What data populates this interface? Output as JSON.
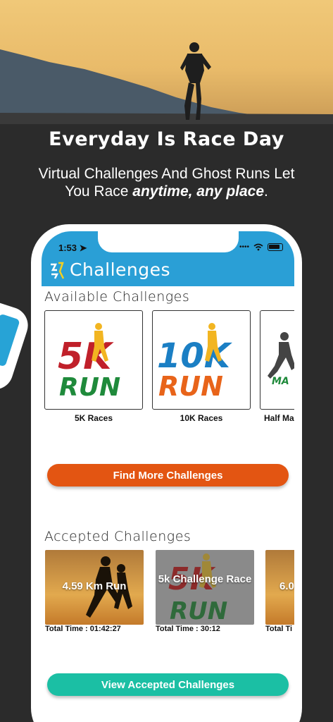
{
  "hero": {
    "headline": "Everyday Is Race Day",
    "subtitle_line1": "Virtual Challenges And Ghost Runs Let",
    "subtitle_line2_pre": "You Race ",
    "subtitle_line2_em": "anytime, any place",
    "subtitle_line2_post": "."
  },
  "status_bar": {
    "time": "1:53"
  },
  "app": {
    "title": "Challenges"
  },
  "available": {
    "title": "Available Challenges",
    "cards": [
      {
        "label": "5K Races",
        "logo_big": "5K",
        "logo_small": "RUN"
      },
      {
        "label": "10K Races",
        "logo_big": "10K",
        "logo_small": "RUN"
      },
      {
        "label": "Half Ma",
        "logo_small": "MA"
      }
    ],
    "button": "Find More Challenges"
  },
  "accepted": {
    "title": "Accepted Challenges",
    "cards": [
      {
        "title": "4.59 Km Run",
        "total_time": "Total Time : 01:42:27",
        "bg_logo_big": "",
        "bg_logo_small": ""
      },
      {
        "title": "5k Challenge Race",
        "total_time": "Total Time : 30:12",
        "bg_logo_big": "5K",
        "bg_logo_small": "RUN"
      },
      {
        "title": "6.0",
        "total_time": "Total Ti"
      }
    ],
    "button": "View Accepted Challenges"
  },
  "colors": {
    "appbar": "#2a9fd6",
    "orange_button": "#e35512",
    "teal_button": "#1bbfa4",
    "background": "#2b2b2b"
  }
}
